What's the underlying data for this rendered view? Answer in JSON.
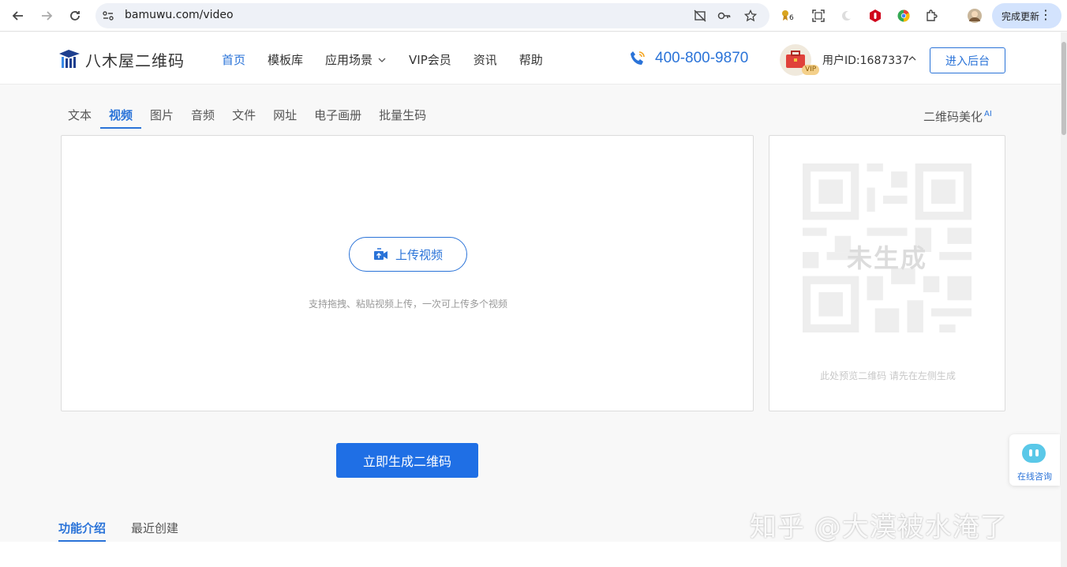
{
  "browser": {
    "url": "bamuwu.com/video",
    "update_label": "完成更新",
    "ext_badge": "6"
  },
  "header": {
    "logo_text": "八木屋二维码",
    "nav": [
      {
        "label": "首页"
      },
      {
        "label": "模板库"
      },
      {
        "label": "应用场景"
      },
      {
        "label": "VIP会员"
      },
      {
        "label": "资讯"
      },
      {
        "label": "帮助"
      }
    ],
    "phone": "400-800-9870",
    "vip_badge": "VIP",
    "user_id": "用户ID:1687337",
    "admin_button": "进入后台"
  },
  "type_tabs": [
    "文本",
    "视频",
    "图片",
    "音频",
    "文件",
    "网址",
    "电子画册",
    "批量生码"
  ],
  "active_type_tab": "视频",
  "beautify": {
    "label": "二维码美化",
    "badge": "AI"
  },
  "upload": {
    "button_label": "上传视频",
    "hint": "支持拖拽、粘贴视频上传，一次可上传多个视频"
  },
  "preview": {
    "status": "未生成",
    "hint": "此处预览二维码 请先在左侧生成"
  },
  "generate_button": "立即生成二维码",
  "bottom_tabs": [
    "功能介绍",
    "最近创建"
  ],
  "consult_label": "在线咨询",
  "watermark": "知乎 @大漠被水淹了",
  "colors": {
    "accent": "#2a73d8",
    "primary_button": "#1f6fe5"
  }
}
